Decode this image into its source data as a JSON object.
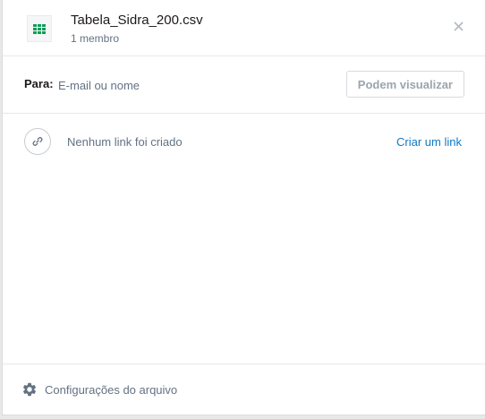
{
  "file": {
    "name": "Tabela_Sidra_200.csv",
    "members": "1 membro",
    "icon": "spreadsheet-icon",
    "icon_color": "#0f9d58"
  },
  "share": {
    "to_label": "Para:",
    "input_placeholder": "E-mail ou nome",
    "permission_button": "Podem visualizar"
  },
  "link": {
    "status_text": "Nenhum link foi criado",
    "create_label": "Criar um link"
  },
  "footer": {
    "settings_label": "Configurações do arquivo"
  },
  "colors": {
    "link_accent": "#0f7ac6"
  }
}
